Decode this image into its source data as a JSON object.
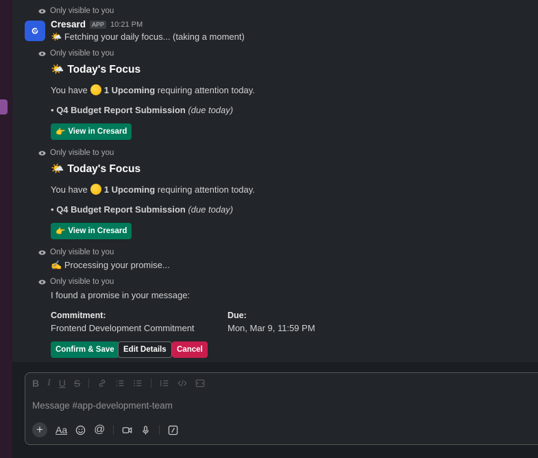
{
  "colors": {
    "green_button": "#007a5a",
    "red_button": "#c91d4e",
    "avatar_bg": "#2e5ee0"
  },
  "notice_text": "Only visible to you",
  "sender": {
    "name": "Cresard",
    "badge": "APP",
    "time": "10:21 PM"
  },
  "messages": {
    "fetching": "Fetching your daily focus... (taking a moment)",
    "focus": {
      "title": "Today's Focus",
      "you_have": "You have",
      "count_label": "1 Upcoming",
      "suffix": "requiring attention today.",
      "bullet": "•",
      "task": "Q4 Budget Report Submission",
      "due_note": "(due today)",
      "button": "View in Cresard"
    },
    "processing": "Processing your promise...",
    "found": "I found a promise in your message:",
    "commitment_label": "Commitment:",
    "commitment_value": "Frontend Development Commitment",
    "due_label": "Due:",
    "due_value": "Mon, Mar 9, 11:59 PM",
    "buttons": {
      "confirm": "Confirm & Save",
      "edit": "Edit Details",
      "cancel": "Cancel"
    }
  },
  "composer": {
    "placeholder": "Message #app-development-team",
    "format_icons": [
      "bold-icon",
      "italic-icon",
      "underline-icon",
      "strikethrough-icon",
      "link-icon",
      "ordered-list-icon",
      "bullet-list-icon",
      "blockquote-icon",
      "code-icon",
      "code-block-icon"
    ],
    "bottom_icons": [
      "plus-icon",
      "text-format-icon",
      "emoji-icon",
      "mention-icon",
      "video-icon",
      "microphone-icon",
      "slash-command-icon"
    ],
    "format_label": "Aa"
  }
}
